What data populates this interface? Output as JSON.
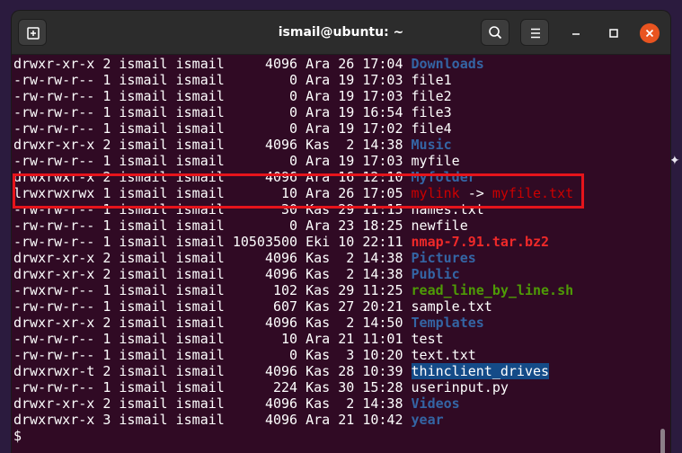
{
  "window": {
    "title": "ismail@ubuntu: ~"
  },
  "icons": {
    "new_tab": "new-tab-icon",
    "search": "search-icon",
    "menu": "hamburger-menu-icon",
    "minimize": "minimize-icon",
    "maximize": "maximize-icon",
    "close": "close-icon"
  },
  "colors": {
    "terminal_bg": "#300a24",
    "directory": "#3465a4",
    "archive": "#ef2929",
    "executable": "#4e9a06",
    "symlink": "#cc0000",
    "highlight_box": "#e5141b"
  },
  "listing": [
    {
      "meta": "drwxr-xr-x 2 ismail ismail     4096 Ara 26 17:04 ",
      "name": "Downloads",
      "type": "dir"
    },
    {
      "meta": "-rw-rw-r-- 1 ismail ismail        0 Ara 19 17:03 ",
      "name": "file1",
      "type": "file"
    },
    {
      "meta": "-rw-rw-r-- 1 ismail ismail        0 Ara 19 17:03 ",
      "name": "file2",
      "type": "file"
    },
    {
      "meta": "-rw-rw-r-- 1 ismail ismail        0 Ara 19 16:54 ",
      "name": "file3",
      "type": "file"
    },
    {
      "meta": "-rw-rw-r-- 1 ismail ismail        0 Ara 19 17:02 ",
      "name": "file4",
      "type": "file"
    },
    {
      "meta": "drwxr-xr-x 2 ismail ismail     4096 Kas  2 14:38 ",
      "name": "Music",
      "type": "dir"
    },
    {
      "meta": "-rw-rw-r-- 1 ismail ismail        0 Ara 19 17:03 ",
      "name": "myfile",
      "type": "file"
    },
    {
      "meta": "drwxrwxr-x 2 ismail ismail     4096 Ara 16 12:10 ",
      "name": "Myfolder",
      "type": "dir"
    },
    {
      "meta": "lrwxrwxrwx 1 ismail ismail       10 Ara 26 17:05 ",
      "name": "mylink",
      "arrow": " -> ",
      "target": "myfile.txt",
      "type": "link"
    },
    {
      "meta": "-rw-rw-r-- 1 ismail ismail       30 Kas 29 11:15 ",
      "name": "names.txt",
      "type": "file"
    },
    {
      "meta": "-rw-rw-r-- 1 ismail ismail        0 Ara 23 18:25 ",
      "name": "newfile",
      "type": "file"
    },
    {
      "meta": "-rw-rw-r-- 1 ismail ismail 10503500 Eki 10 22:11 ",
      "name": "nmap-7.91.tar.bz2",
      "type": "archive"
    },
    {
      "meta": "drwxr-xr-x 2 ismail ismail     4096 Kas  2 14:38 ",
      "name": "Pictures",
      "type": "dir"
    },
    {
      "meta": "drwxr-xr-x 2 ismail ismail     4096 Kas  2 14:38 ",
      "name": "Public",
      "type": "dir"
    },
    {
      "meta": "-rwxrw-r-- 1 ismail ismail      102 Kas 29 11:25 ",
      "name": "read_line_by_line.sh",
      "type": "exe"
    },
    {
      "meta": "-rw-rw-r-- 1 ismail ismail      607 Kas 27 20:21 ",
      "name": "sample.txt",
      "type": "file"
    },
    {
      "meta": "drwxr-xr-x 2 ismail ismail     4096 Kas  2 14:50 ",
      "name": "Templates",
      "type": "dir"
    },
    {
      "meta": "-rw-rw-r-- 1 ismail ismail       10 Ara 21 11:01 ",
      "name": "test",
      "type": "file"
    },
    {
      "meta": "-rw-rw-r-- 1 ismail ismail        0 Kas  3 10:20 ",
      "name": "text.txt",
      "type": "file"
    },
    {
      "meta": "drwxrwxr-t 2 ismail ismail     4096 Kas 28 10:39 ",
      "name": "thinclient_drives",
      "type": "sticky"
    },
    {
      "meta": "-rw-rw-r-- 1 ismail ismail      224 Kas 30 15:28 ",
      "name": "userinput.py",
      "type": "file"
    },
    {
      "meta": "drwxr-xr-x 2 ismail ismail     4096 Kas  2 14:38 ",
      "name": "Videos",
      "type": "dir"
    },
    {
      "meta": "drwxrwxr-x 3 ismail ismail     4096 Ara 21 10:42 ",
      "name": "year",
      "type": "dir"
    }
  ],
  "prompt": "$"
}
